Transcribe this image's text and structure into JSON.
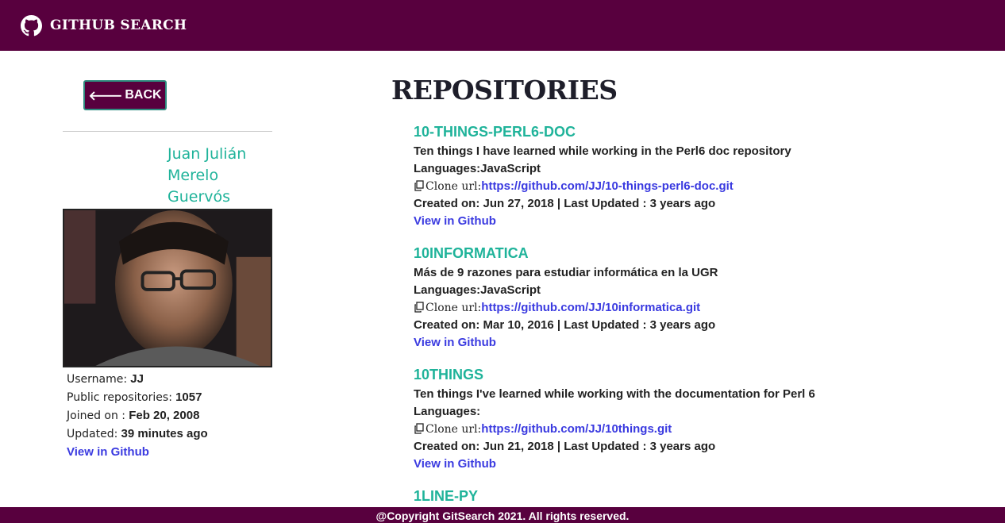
{
  "navbar": {
    "brand": "GITHUB SEARCH"
  },
  "back_button": {
    "label": "BACK"
  },
  "profile": {
    "name": "Juan Julián Merelo Guervós",
    "username_label": "Username:",
    "username": "JJ",
    "repos_label": "Public repositories:",
    "repos": "1057",
    "joined_label": "Joined on :",
    "joined": "Feb 20, 2008",
    "updated_label": "Updated:",
    "updated": "39 minutes ago",
    "view_link": "View in Github"
  },
  "repositories_heading": "REPOSITORIES",
  "repositories": [
    {
      "name": "10-THINGS-PERL6-DOC",
      "description": "Ten things I have learned while working in the Perl6 doc repository",
      "languages": "Languages:JavaScript",
      "clone_label": "Clone url:",
      "clone_url": "https://github.com/JJ/10-things-perl6-doc.git",
      "dates": "Created on: Jun 27, 2018 | Last Updated : 3 years ago",
      "view_link": "View in Github"
    },
    {
      "name": "10INFORMATICA",
      "description": "Más de 9 razones para estudiar informática en la UGR",
      "languages": "Languages:JavaScript",
      "clone_label": "Clone url:",
      "clone_url": "https://github.com/JJ/10informatica.git",
      "dates": "Created on: Mar 10, 2016 | Last Updated : 3 years ago",
      "view_link": "View in Github"
    },
    {
      "name": "10THINGS",
      "description": "Ten things I've learned while working with the documentation for Perl 6",
      "languages": "Languages:",
      "clone_label": "Clone url:",
      "clone_url": "https://github.com/JJ/10things.git",
      "dates": "Created on: Jun 21, 2018 | Last Updated : 3 years ago",
      "view_link": "View in Github"
    },
    {
      "name": "1LINE-PY"
    }
  ],
  "footer": {
    "text": "@Copyright GitSearch 2021. All rights reserved."
  },
  "colors": {
    "brand": "#58003e",
    "accent": "#1fb39a",
    "link": "#3a3ae0"
  }
}
